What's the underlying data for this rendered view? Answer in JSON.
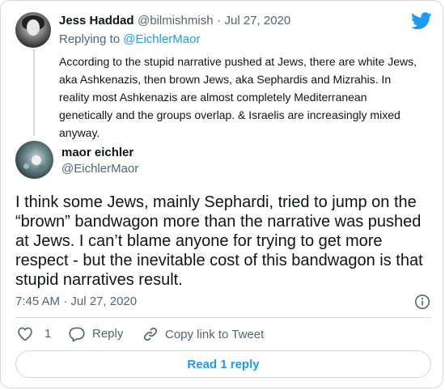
{
  "parent_tweet": {
    "name": "Jess Haddad",
    "handle": "@bilmishmish",
    "separator": "·",
    "date": "Jul 27, 2020",
    "replying_prefix": "Replying to ",
    "replying_handle": "@EichlerMaor",
    "text": "According to the stupid narrative pushed at Jews, there are white Jews, aka Ashkenazis, then brown Jews, aka Sephardis and Mizrahis. In reality most Ashkenazis are almost completely Mediterranean genetically and the groups overlap. & Israelis are increasingly mixed anyway."
  },
  "main_tweet": {
    "name": "maor eichler",
    "handle": "@EichlerMaor",
    "text": "I think some Jews, mainly Sephardi, tried to jump on the “brown” bandwagon more than the narrative was pushed at Jews. I can’t blame anyone for trying to get more respect - but the inevitable cost of this bandwagon is that stupid narratives result.",
    "timestamp": "7:45 AM · Jul 27, 2020"
  },
  "actions": {
    "like_count": "1",
    "reply_label": "Reply",
    "copy_link_label": "Copy link to Tweet"
  },
  "read_replies_label": "Read 1 reply",
  "colors": {
    "twitter_blue": "#1d9bf0",
    "secondary_text": "#536471",
    "border": "#cfd9de"
  },
  "icons": [
    "twitter-bird-icon",
    "info-icon",
    "heart-icon",
    "reply-bubble-icon",
    "link-icon"
  ]
}
